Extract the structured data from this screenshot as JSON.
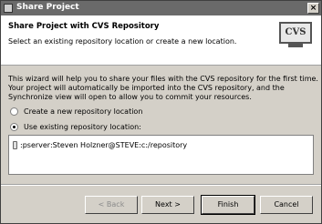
{
  "window": {
    "title": "Share Project",
    "close_label": "×"
  },
  "banner": {
    "title": "Share Project with CVS Repository",
    "subtitle": "Select an existing repository location or create a new location.",
    "logo_text": "CVS"
  },
  "description": "This wizard will help you to share your files with the CVS repository for the first time. Your project will automatically be imported into the CVS repository, and the Synchronize view will open to allow you to commit your resources.",
  "options": {
    "create_new": {
      "label": "Create a new repository location",
      "selected": false
    },
    "use_existing": {
      "label": "Use existing repository location:",
      "selected": true
    }
  },
  "repositories": [
    {
      "label": ":pserver:Steven Holzner@STEVE:c:/repository"
    }
  ],
  "buttons": {
    "back": "< Back",
    "next": "Next >",
    "finish": "Finish",
    "cancel": "Cancel"
  }
}
